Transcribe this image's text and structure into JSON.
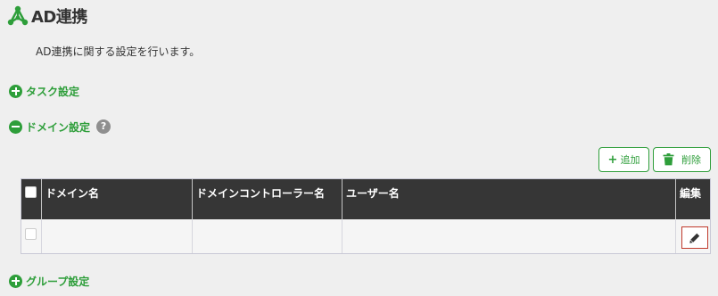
{
  "page": {
    "title": "AD連携",
    "description": "AD連携に関する設定を行います。"
  },
  "sections": {
    "task": {
      "label": "タスク設定",
      "state": "collapsed"
    },
    "domain": {
      "label": "ドメイン設定",
      "state": "expanded",
      "help": "?"
    },
    "group": {
      "label": "グループ設定",
      "state": "collapsed"
    }
  },
  "toolbar": {
    "add_label": "追加",
    "add_symbol": "+",
    "delete_label": "削除"
  },
  "table": {
    "columns": [
      "ドメイン名",
      "ドメインコントローラー名",
      "ユーザー名",
      "編集"
    ],
    "rows": [
      {
        "domain": "",
        "controller": "",
        "user": "",
        "checked": false
      }
    ]
  },
  "icons": {
    "title": "triangle-nodes-icon",
    "expand": "plus-circle-icon",
    "collapse": "minus-circle-icon",
    "help": "question-circle-icon",
    "delete": "trash-icon",
    "edit": "pencil-icon"
  },
  "colors": {
    "accent": "#2e9e3a",
    "header_bg": "#363636",
    "edit_border": "#c0392b",
    "page_bg": "#efefef"
  }
}
